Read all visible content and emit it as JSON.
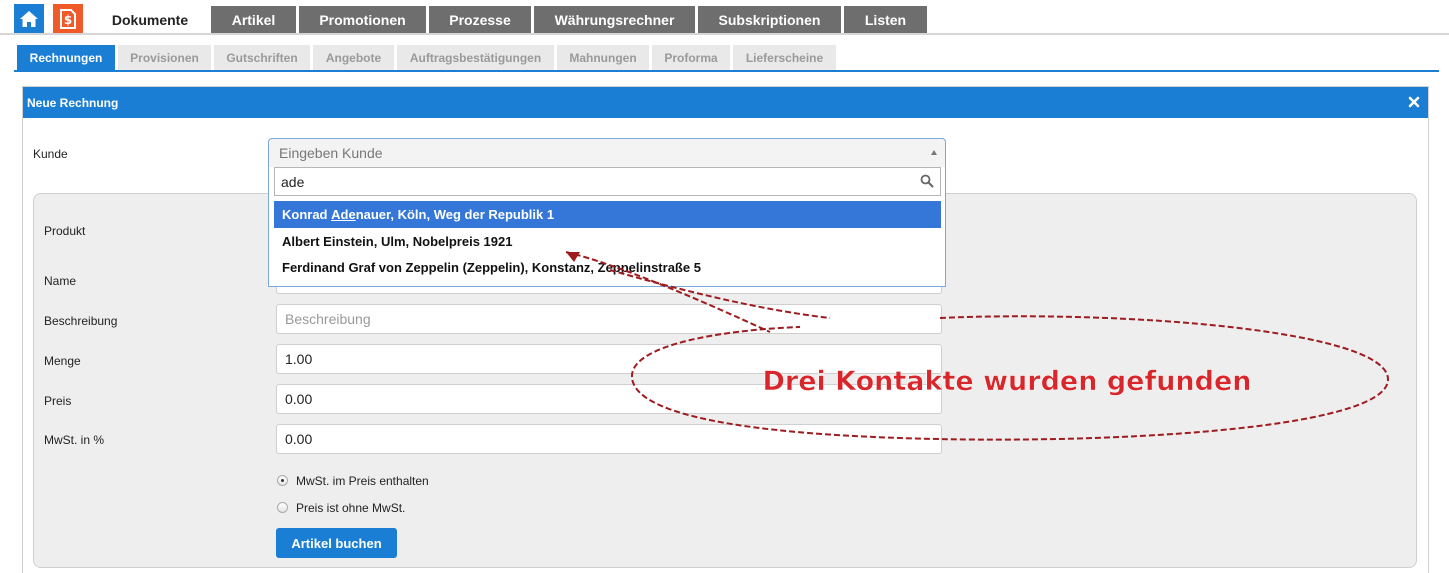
{
  "nav": {
    "tabs": [
      "Dokumente",
      "Artikel",
      "Promotionen",
      "Prozesse",
      "Währungsrechner",
      "Subskriptionen",
      "Listen"
    ],
    "active_tab": "Dokumente",
    "icons": [
      "home-icon",
      "document-dollar-icon"
    ]
  },
  "subnav": {
    "tabs": [
      "Rechnungen",
      "Provisionen",
      "Gutschriften",
      "Angebote",
      "Auftragsbestätigungen",
      "Mahnungen",
      "Proforma",
      "Lieferscheine"
    ],
    "active_tab": "Rechnungen"
  },
  "panel": {
    "title": "Neue Rechnung",
    "close_icon": "close-icon"
  },
  "form": {
    "kunde_label": "Kunde",
    "kunde_placeholder": "Eingeben Kunde",
    "search_value": "ade",
    "results": [
      {
        "pre": "Konrad ",
        "match": "Ade",
        "post": "nauer, Köln, Weg der Republik 1"
      },
      {
        "pre": "Albert Einstein, Ulm, Nobelpreis 1921",
        "match": "",
        "post": ""
      },
      {
        "pre": "Ferdinand Graf von Zeppelin (Zeppelin), Konstanz, Zeppelinstraße 5",
        "match": "",
        "post": ""
      }
    ],
    "produkt_label": "Produkt",
    "name_label": "Name",
    "beschreibung_label": "Beschreibung",
    "beschreibung_placeholder": "Beschreibung",
    "menge_label": "Menge",
    "menge_value": "1.00",
    "preis_label": "Preis",
    "preis_value": "0.00",
    "mwst_label": "MwSt. in %",
    "mwst_value": "0.00",
    "radio_incl": "MwSt. im Preis enthalten",
    "radio_excl": "Preis ist ohne MwSt.",
    "radio_selected": "MwSt. im Preis enthalten",
    "book_button": "Artikel buchen"
  },
  "annotation": {
    "text": "Drei Kontakte wurden gefunden",
    "color": "#d9262a"
  },
  "colors": {
    "accent": "#1a7fd4",
    "highlight": "#3477d9",
    "doc_icon_bg": "#f05a28",
    "tab_inactive": "#6e6e6e"
  }
}
